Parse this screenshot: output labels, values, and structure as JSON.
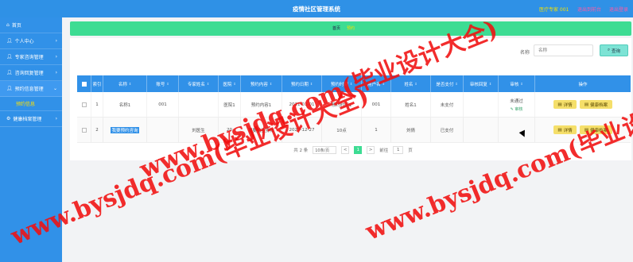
{
  "header": {
    "title": "疫情社区管理系统",
    "user_label": "医疗专家 001",
    "link_personal": "退出到前台",
    "link_logout": "退出登录"
  },
  "sidebar": {
    "items": [
      {
        "label": "首页",
        "icon": "home-icon"
      },
      {
        "label": "个人中心",
        "icon": "user-icon"
      },
      {
        "label": "专家咨询管理",
        "icon": "user-icon"
      },
      {
        "label": "咨询回复管理",
        "icon": "user-icon"
      },
      {
        "label": "预约信息管理",
        "icon": "user-icon"
      },
      {
        "label": "预约信息",
        "sub": true
      },
      {
        "label": "健康档案管理",
        "icon": "gear-icon"
      }
    ]
  },
  "breadcrumb": {
    "home": "首页",
    "current": "预约"
  },
  "search": {
    "label": "名称",
    "placeholder": "名称",
    "button": "查询"
  },
  "table": {
    "headers": [
      "",
      "索引",
      "名称",
      "账号",
      "专家姓名",
      "医院",
      "预约内容",
      "预约日期",
      "预约时间",
      "用户名",
      "姓名",
      "是否支付",
      "审核回复",
      "审核",
      "操作"
    ],
    "rows": [
      {
        "index": "1",
        "name": "名称1",
        "account": "001",
        "expert": "",
        "hospital": "医院1",
        "content": "预约内容1",
        "date": "2021-01-01",
        "time": "预约时间1",
        "username": "001",
        "person": "姓名1",
        "paid": "未支付",
        "reply": "",
        "audit": "未通过",
        "audit_action": "审核"
      },
      {
        "index": "2",
        "name": "我要预约咨询",
        "account": "",
        "expert": "刘医生",
        "hospital": "20",
        "content": "我要检查身体",
        "date": "2020-12-27",
        "time": "10点",
        "username": "1",
        "person": "刘倩",
        "paid": "已支付",
        "reply": "",
        "audit": "",
        "audit_action": ""
      }
    ],
    "btn_detail": "详情",
    "btn_health": "健康档案"
  },
  "pager": {
    "total": "共 2 条",
    "page_size": "10条/页",
    "prev": "<",
    "current": "1",
    "next": ">",
    "goto": "前往",
    "goto_page": "1",
    "page_unit": "页"
  },
  "watermark": {
    "text1": "www.bysjdq.com(毕业设计大全)",
    "text2": "www.bysjdq.com(毕业设计大全)",
    "text3": "www.bysjdq.com(毕业设计大全)"
  },
  "colors": {
    "topbar": "#2f91e6",
    "sidebar": "#3191e8",
    "accent": "#3ddc93",
    "warn": "#f5df6a",
    "watermark": "#f00f0f"
  }
}
